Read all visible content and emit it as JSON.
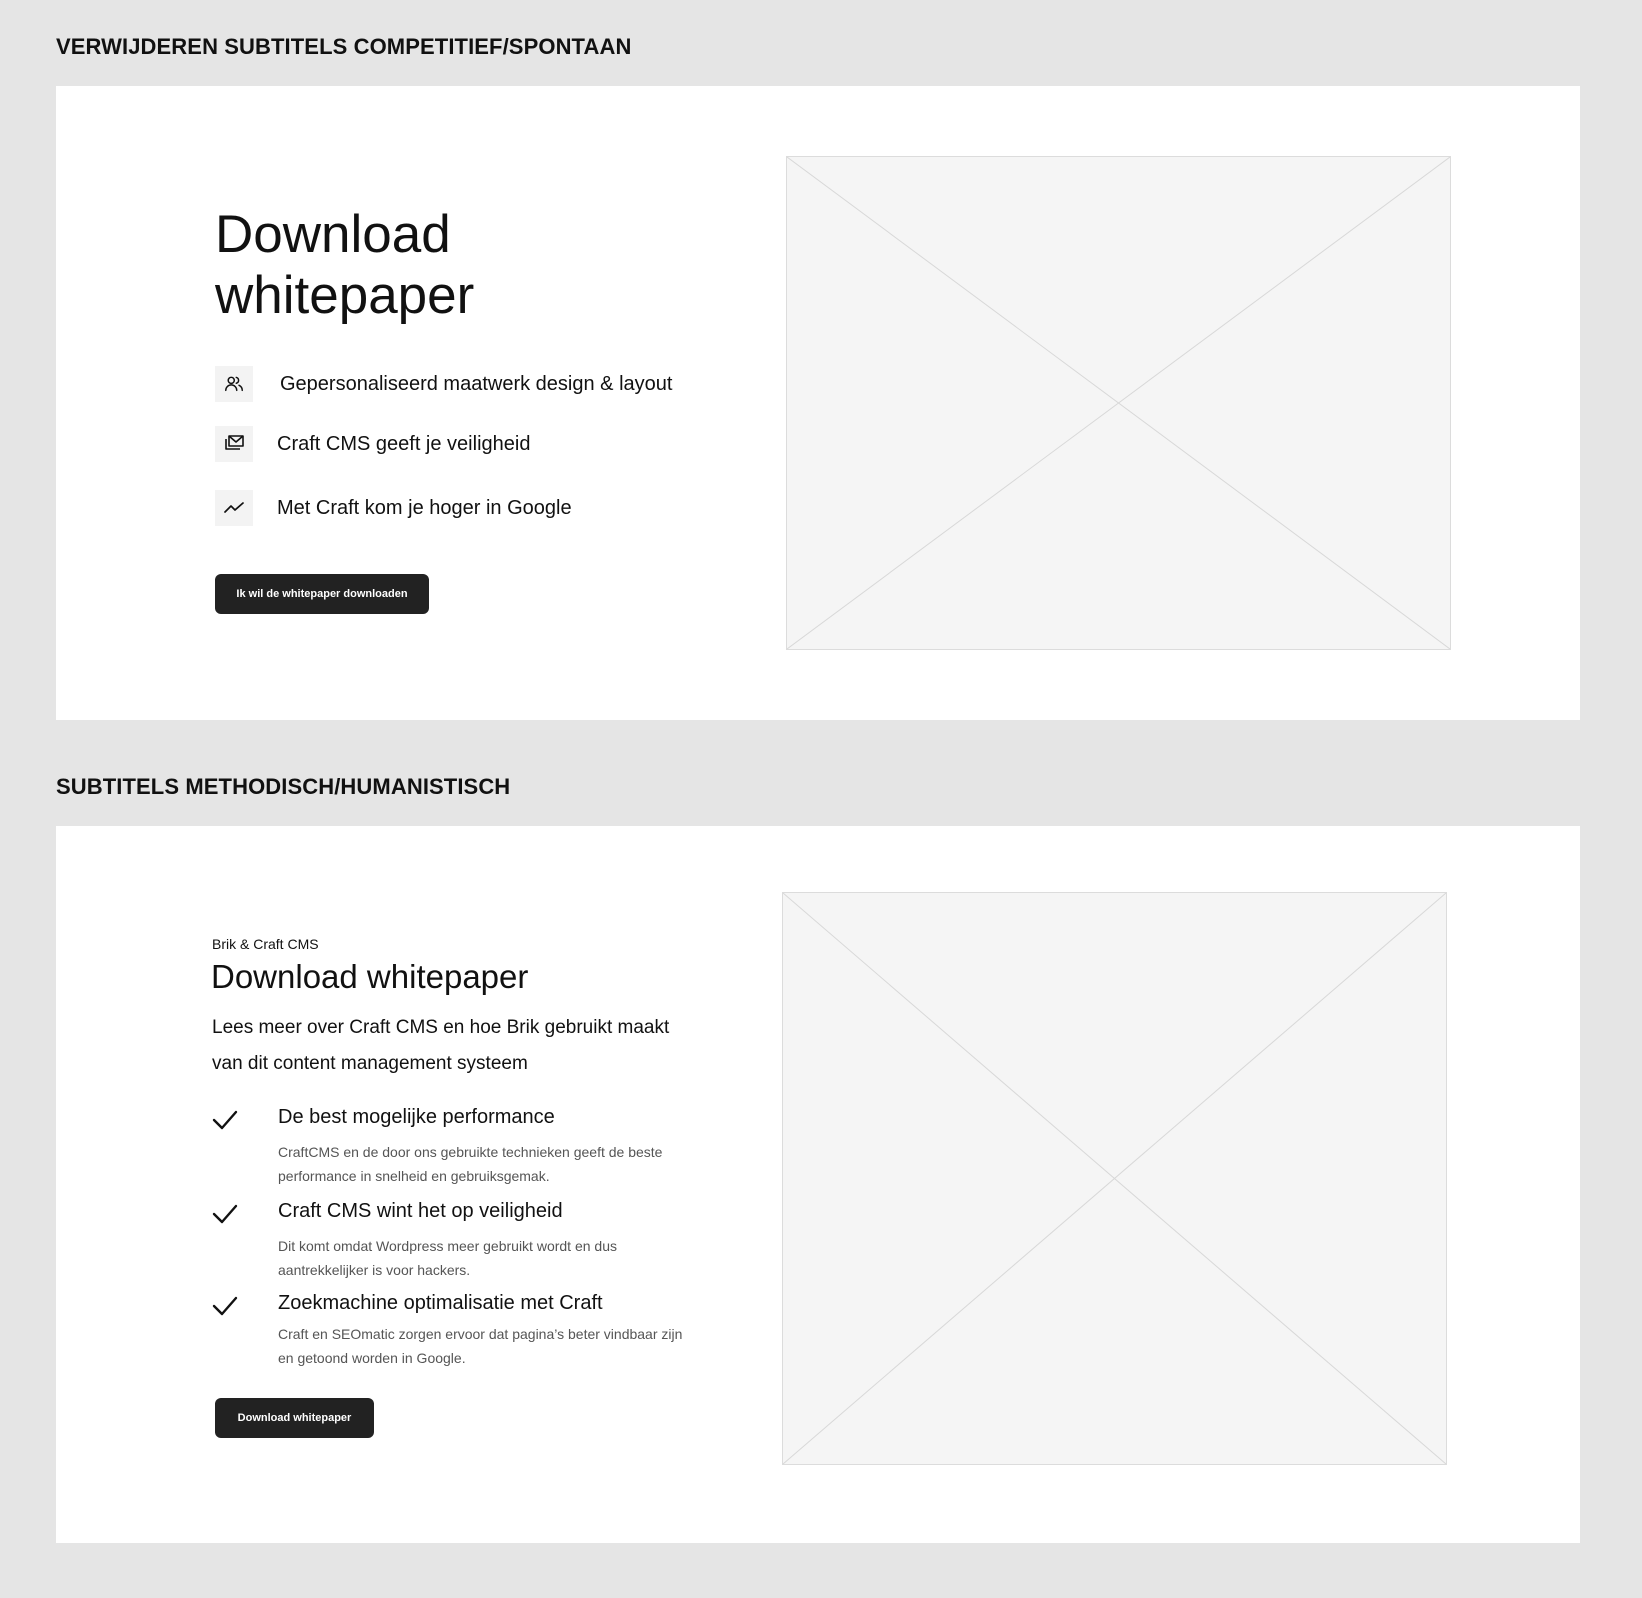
{
  "section1": {
    "heading": "VERWIJDEREN SUBTITELS COMPETITIEF/SPONTAAN",
    "title_line1": "Download",
    "title_line2": "whitepaper",
    "features": [
      {
        "icon": "users-icon",
        "label": "Gepersonaliseerd maatwerk design & layout"
      },
      {
        "icon": "mail-stack-icon",
        "label": "Craft CMS geeft je veiligheid"
      },
      {
        "icon": "trend-line-icon",
        "label": "Met Craft kom je hoger in Google"
      }
    ],
    "button_label": "Ik wil de whitepaper downloaden"
  },
  "section2": {
    "heading": "SUBTITELS METHODISCH/HUMANISTISCH",
    "eyebrow": "Brik & Craft CMS",
    "title": "Download whitepaper",
    "intro": "Lees meer over Craft CMS en hoe Brik gebruikt maakt van dit content management systeem",
    "items": [
      {
        "title": "De best mogelijke performance",
        "desc": "CraftCMS en de door ons gebruikte technieken geeft de beste performance in snelheid en gebruiksgemak."
      },
      {
        "title": "Craft CMS wint het op veiligheid",
        "desc": "Dit komt omdat Wordpress meer gebruikt wordt en dus aantrekkelijker is voor hackers."
      },
      {
        "title": "Zoekmachine optimalisatie met Craft",
        "desc": "Craft en SEOmatic zorgen ervoor dat pagina’s beter vindbaar zijn en getoond worden in Google."
      }
    ],
    "button_label": "Download whitepaper"
  },
  "colors": {
    "page_background": "#e5e5e5",
    "panel_background": "#ffffff",
    "button_background": "#222222",
    "placeholder_fill": "#f5f5f5"
  }
}
